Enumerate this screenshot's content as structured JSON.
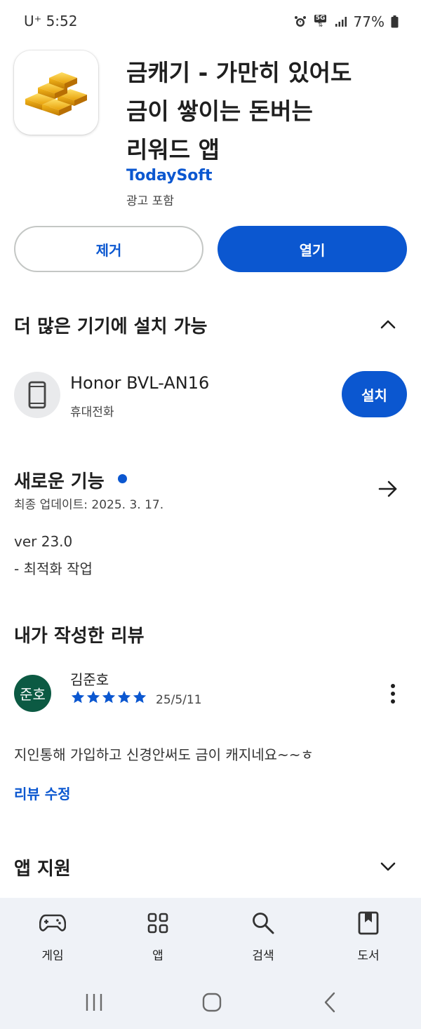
{
  "status_bar": {
    "carrier": "U⁺",
    "time": "5:52",
    "network": "5G",
    "battery": "77%",
    "icons": [
      "alarm-icon",
      "5g-icon",
      "signal-icon",
      "battery-icon"
    ]
  },
  "app": {
    "icon": "gold-bars-icon",
    "title_lines": [
      "금캐기 - 가만히 있어도",
      "금이 쌓이는 돈버는",
      "리워드 앱"
    ],
    "developer": "TodaySoft",
    "ads_note": "광고 포함"
  },
  "actions": {
    "uninstall": "제거",
    "open": "열기"
  },
  "devices": {
    "title": "더 많은 기기에 설치 가능",
    "device_name": "Honor BVL-AN16",
    "device_type": "휴대전화",
    "install": "설치"
  },
  "whats_new": {
    "title": "새로운 기능",
    "updated": "최종 업데이트: 2025. 3. 17.",
    "notes": [
      "ver 23.0",
      "- 최적화 작업"
    ]
  },
  "my_review": {
    "title": "내가 작성한 리뷰",
    "avatar_text": "준호",
    "reviewer": "김준호",
    "rating": 5,
    "date": "25/5/11",
    "text": "지인통해 가입하고 신경안써도 금이 캐지네요~~ㅎ",
    "edit": "리뷰 수정"
  },
  "app_support": {
    "title": "앱 지원"
  },
  "bottom_nav": {
    "items": [
      {
        "label": "게임",
        "icon": "gamepad-icon"
      },
      {
        "label": "앱",
        "icon": "apps-grid-icon"
      },
      {
        "label": "검색",
        "icon": "search-icon"
      },
      {
        "label": "도서",
        "icon": "book-icon"
      }
    ]
  },
  "colors": {
    "accent": "#0b57d0",
    "avatar_bg": "#0c5a43",
    "nav_bg": "#eff2f7"
  }
}
